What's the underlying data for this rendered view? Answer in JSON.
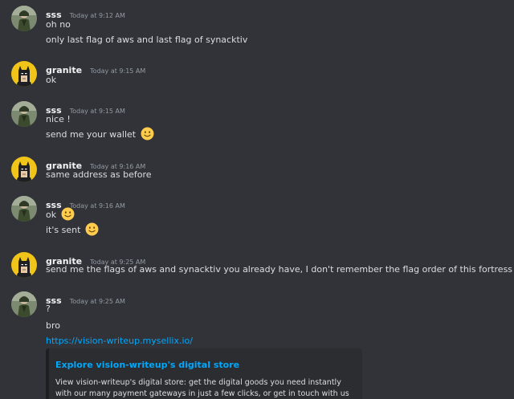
{
  "messages": [
    {
      "author": "sss",
      "time": "Today at 9:12 AM",
      "lines": [
        "oh no",
        "only last flag of aws and last flag of synacktiv"
      ]
    },
    {
      "author": "granite",
      "time": "Today at 9:15 AM",
      "lines": [
        "ok"
      ]
    },
    {
      "author": "sss",
      "time": "Today at 9:15 AM",
      "lines": [
        "nice !",
        "send me your wallet"
      ]
    },
    {
      "author": "granite",
      "time": "Today at 9:16 AM",
      "lines": [
        "same address as before"
      ]
    },
    {
      "author": "sss",
      "time": "Today at 9:16 AM",
      "lines": [
        "ok",
        "it's sent"
      ]
    },
    {
      "author": "granite",
      "time": "Today at 9:25 AM",
      "lines": [
        "send me the flags of aws and synacktiv you already have, I don't remember the flag order of this fortress"
      ]
    },
    {
      "author": "sss",
      "time": "Today at 9:25 AM",
      "lines": [
        "?",
        "bro",
        "https://vision-writeup.mysellix.io/"
      ]
    }
  ],
  "embed": {
    "title": "Explore vision-writeup's digital store",
    "description": "View vision-writeup's digital store: get the digital goods you need instantly with our many payment gateways in just a few clicks, or get in touch with us should you"
  },
  "icons": {
    "sss_avatar": "green-figure-avatar",
    "granite_avatar": "batman-avatar",
    "emoji": "slightly-smiling-face"
  },
  "colors": {
    "background": "#313338",
    "username": "#f2f3f5",
    "timestamp": "#949ba4",
    "text": "#dbdee1",
    "link": "#00a8fc",
    "embed_bg": "#2b2d31",
    "avatar_yellow": "#f0c419"
  }
}
